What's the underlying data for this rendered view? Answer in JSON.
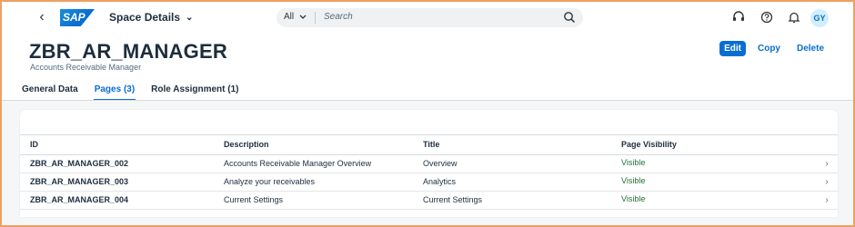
{
  "shell": {
    "logo_text": "SAP",
    "app_title": "Space Details",
    "search_scope": "All",
    "search_placeholder": "Search",
    "avatar_initials": "GY",
    "icons": [
      "back-icon",
      "chevron-down-icon",
      "search-icon",
      "headset-icon",
      "help-icon",
      "bell-icon"
    ]
  },
  "header": {
    "title": "ZBR_AR_MANAGER",
    "subtitle": "Accounts Receivable Manager",
    "actions": {
      "edit": "Edit",
      "copy": "Copy",
      "delete": "Delete"
    }
  },
  "tabs": [
    {
      "label": "General Data",
      "active": false
    },
    {
      "label": "Pages (3)",
      "active": true
    },
    {
      "label": "Role Assignment (1)",
      "active": false
    }
  ],
  "table": {
    "columns": [
      "ID",
      "Description",
      "Title",
      "Page Visibility"
    ],
    "rows": [
      {
        "id": "ZBR_AR_MANAGER_002",
        "description": "Accounts Receivable Manager Overview",
        "title": "Overview",
        "visibility": "Visible"
      },
      {
        "id": "ZBR_AR_MANAGER_003",
        "description": "Analyze your receivables",
        "title": "Analytics",
        "visibility": "Visible"
      },
      {
        "id": "ZBR_AR_MANAGER_004",
        "description": "Current Settings",
        "title": "Current Settings",
        "visibility": "Visible"
      }
    ]
  },
  "colors": {
    "accent": "#0a6ed1",
    "positive": "#256f3a",
    "frame_border": "#f0a060"
  }
}
